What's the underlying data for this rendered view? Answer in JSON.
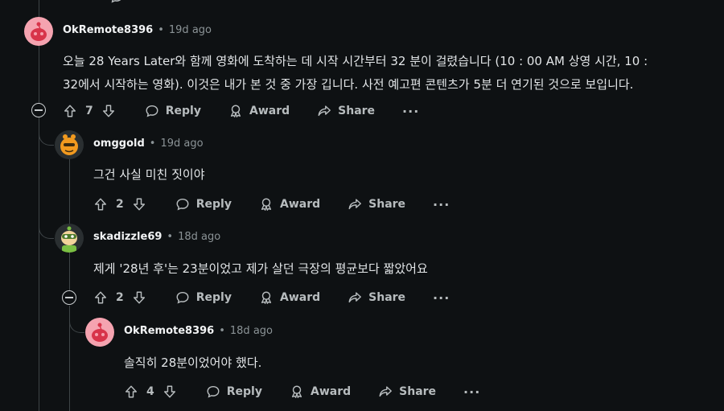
{
  "comments": [
    {
      "author": "OkRemote8396",
      "age": "19d ago",
      "text_lines": [
        "오늘 28 Years Later와 함께 영화에 도착하는 데 시작 시간부터 32 분이 걸렸습니다 (10 : 00 AM 상영 시간, 10 :",
        "32에서 시작하는 영화). 이것은 내가 본 것 중 가장 깁니다. 사전 예고편 콘텐츠가 5분 더 연기된 것으로 보입니다."
      ],
      "score": "7",
      "reply_label": "Reply",
      "award_label": "Award",
      "share_label": "Share",
      "more_label": "···"
    },
    {
      "author": "omggold",
      "age": "19d ago",
      "text_lines": [
        "그건 사실 미친 짓이야"
      ],
      "score": "2",
      "reply_label": "Reply",
      "award_label": "Award",
      "share_label": "Share",
      "more_label": "···"
    },
    {
      "author": "skadizzle69",
      "age": "18d ago",
      "text_lines": [
        "제게 '28년 후'는 23분이었고 제가 살던 극장의 평균보다 짧았어요"
      ],
      "score": "2",
      "reply_label": "Reply",
      "award_label": "Award",
      "share_label": "Share",
      "more_label": "···"
    },
    {
      "author": "OkRemote8396",
      "age": "18d ago",
      "text_lines": [
        "솔직히 28분이었어야 했다."
      ],
      "score": "4",
      "reply_label": "Reply",
      "award_label": "Award",
      "share_label": "Share",
      "more_label": "···"
    }
  ],
  "separator": "•",
  "colors": {
    "background": "#0e1113",
    "thread_line": "#3e4447",
    "text": "#e3e6e8",
    "muted": "#8b9396"
  }
}
